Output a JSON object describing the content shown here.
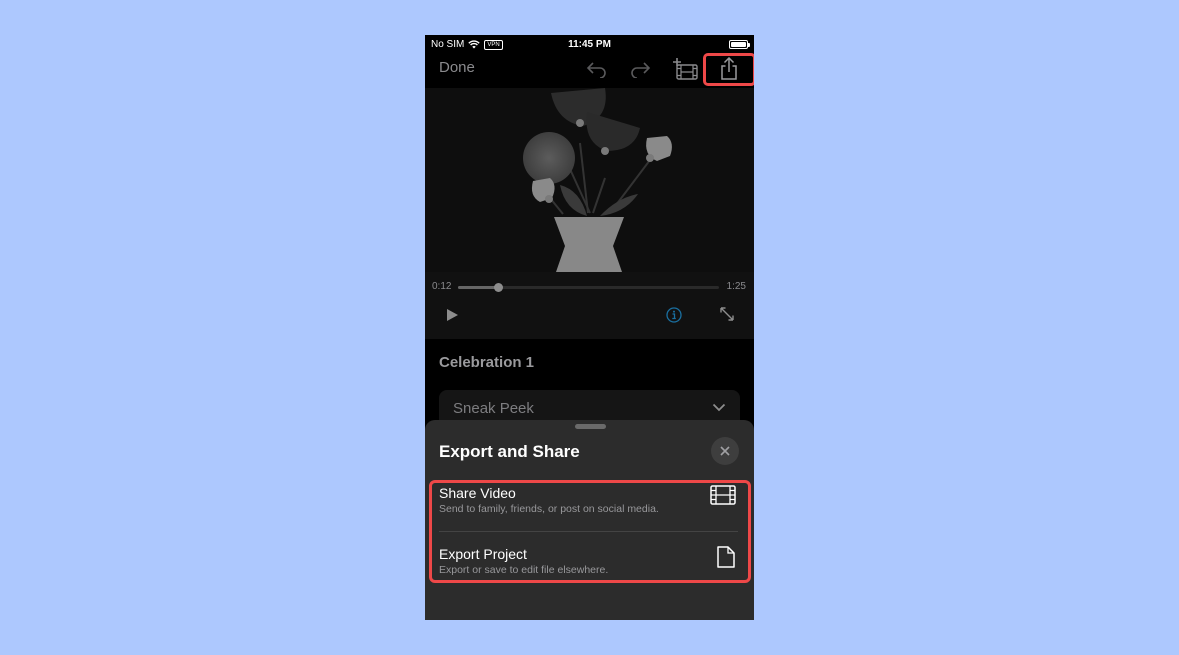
{
  "status_bar": {
    "carrier": "No SIM",
    "vpn": "VPN",
    "time": "11:45 PM"
  },
  "toolbar": {
    "done_label": "Done",
    "icons": [
      "undo-icon",
      "redo-icon",
      "add-media-icon",
      "share-icon"
    ]
  },
  "player": {
    "current_time": "0:12",
    "total_time": "1:25",
    "progress": 0.155
  },
  "project": {
    "title": "Celebration 1",
    "theme_selected": "Sneak Peek"
  },
  "sheet": {
    "title": "Export and Share",
    "options": [
      {
        "name": "Share Video",
        "description": "Send to family, friends, or post on social media.",
        "icon": "film-icon"
      },
      {
        "name": "Export Project",
        "description": "Export or save to edit file elsewhere.",
        "icon": "document-icon"
      }
    ]
  },
  "colors": {
    "highlight": "#ee4848",
    "info_accent": "#1a6fa0",
    "background": "#adc8fe"
  }
}
